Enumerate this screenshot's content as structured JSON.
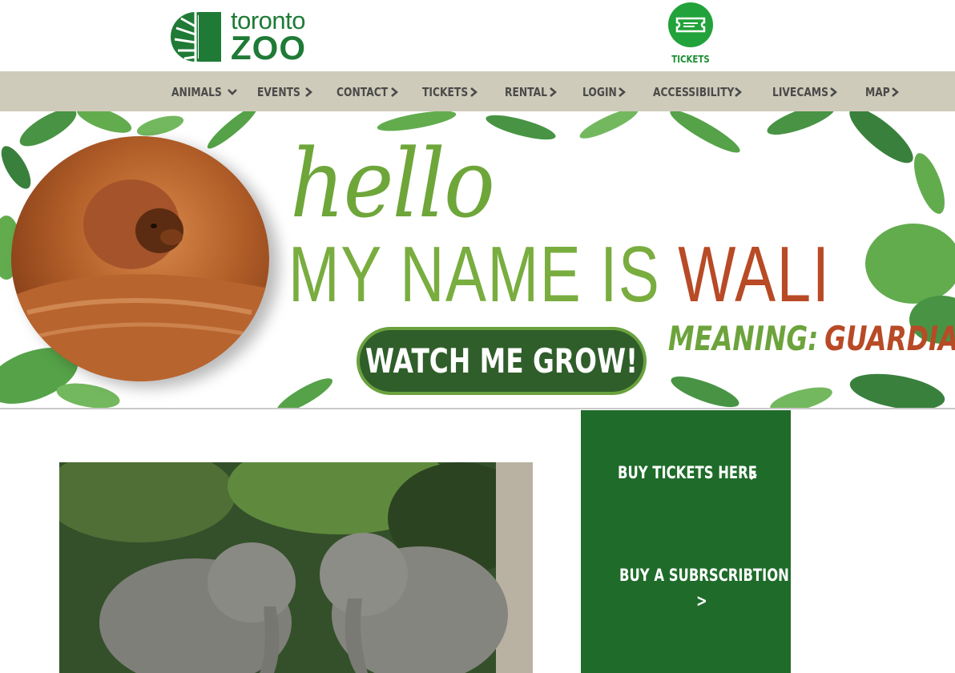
{
  "header": {
    "logo_top": "toronto",
    "logo_bottom": "ZOO",
    "tickets_label": "TICKETS"
  },
  "nav": {
    "items": [
      {
        "label": "ANIMALS",
        "arrow": "chevron-down"
      },
      {
        "label": "EVENTS",
        "arrow": "chevron-right"
      },
      {
        "label": "CONTACT",
        "arrow": "chevron-right"
      },
      {
        "label": "TICKETS",
        "arrow": "chevron-right"
      },
      {
        "label": "RENTAL",
        "arrow": "chevron-right"
      },
      {
        "label": "LOGIN",
        "arrow": "chevron-right"
      },
      {
        "label": "ACCESSIBILITY",
        "arrow": "chevron-right"
      },
      {
        "label": "LIVECAMS",
        "arrow": "chevron-right"
      },
      {
        "label": "MAP",
        "arrow": "chevron-right"
      }
    ]
  },
  "hero": {
    "hello": "hello",
    "name_prefix": "MY NAME IS",
    "name": "WALI",
    "meaning_label": "MEANING:",
    "meaning_value": "GUARDIAN",
    "button_label": "WATCH ME GROW!"
  },
  "side": {
    "buy_tickets": "BUY TICKETS HERE",
    "buy_subscription_line1": "BUY A SUBRSCRIBTION",
    "buy_subscription_line2": ">"
  },
  "colors": {
    "brand_green": "#1f7a36",
    "nav_bg": "#cfcbba",
    "panel_green": "#1f6b2a",
    "hero_green": "#79ad3f",
    "hero_red": "#b84a26"
  }
}
